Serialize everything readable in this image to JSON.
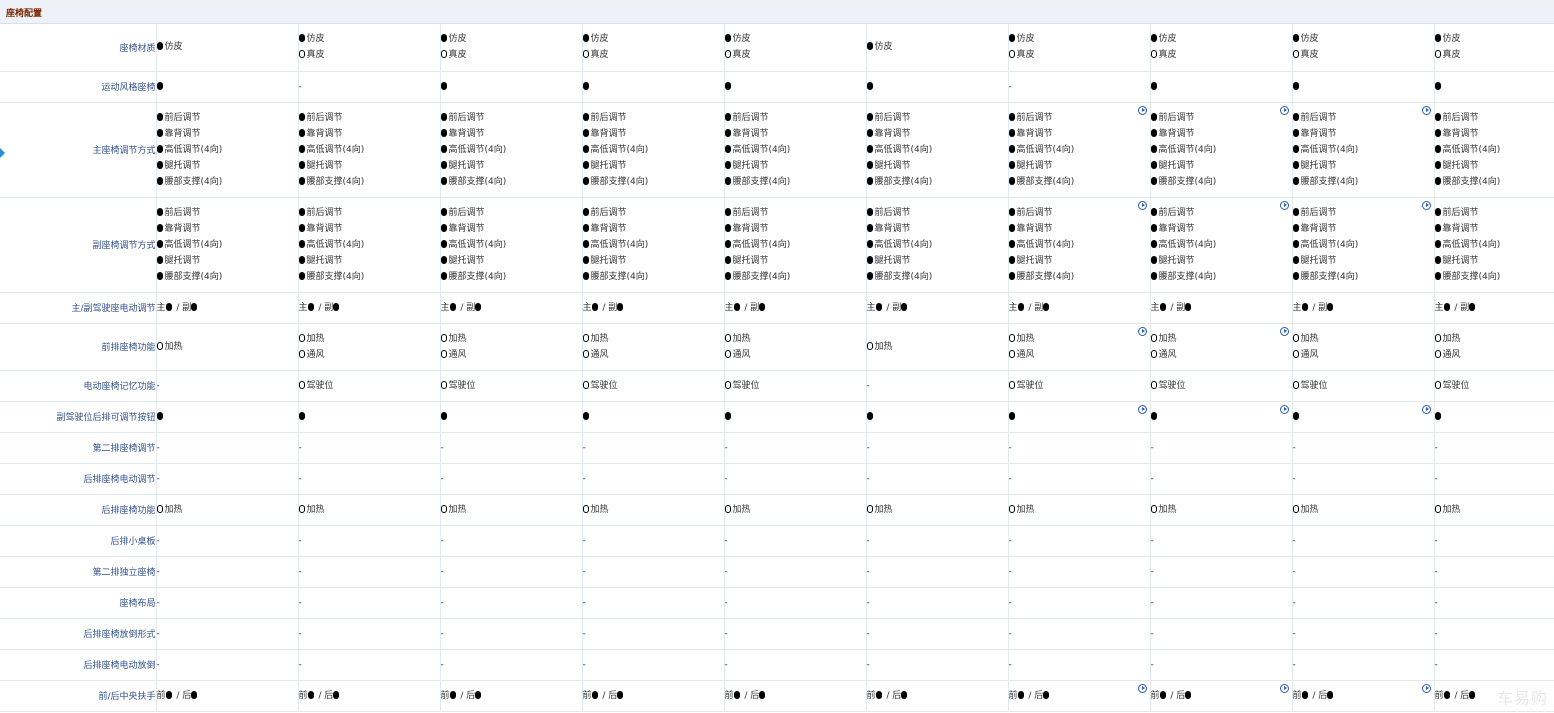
{
  "section_title": "座椅配置",
  "watermark": "车易购",
  "marks": {
    "filled": "●",
    "hollow": "○"
  },
  "rows": [
    {
      "label": "座椅材质",
      "h": 47,
      "cells": [
        [
          [
            "f",
            "仿皮"
          ]
        ],
        [
          [
            "f",
            "仿皮"
          ],
          [
            "o",
            "真皮"
          ]
        ],
        [
          [
            "f",
            "仿皮"
          ],
          [
            "o",
            "真皮"
          ]
        ],
        [
          [
            "f",
            "仿皮"
          ],
          [
            "o",
            "真皮"
          ]
        ],
        [
          [
            "f",
            "仿皮"
          ],
          [
            "o",
            "真皮"
          ]
        ],
        [
          [
            "f",
            "仿皮"
          ]
        ],
        [
          [
            "f",
            "仿皮"
          ],
          [
            "o",
            "真皮"
          ]
        ],
        [
          [
            "f",
            "仿皮"
          ],
          [
            "o",
            "真皮"
          ]
        ],
        [
          [
            "f",
            "仿皮"
          ],
          [
            "o",
            "真皮"
          ]
        ],
        [
          [
            "f",
            "仿皮"
          ],
          [
            "o",
            "真皮"
          ]
        ]
      ],
      "play": []
    },
    {
      "label": "运动风格座椅",
      "h": 31,
      "cells": [
        [
          [
            "f",
            ""
          ]
        ],
        [
          [
            "-",
            "-"
          ]
        ],
        [
          [
            "f",
            ""
          ]
        ],
        [
          [
            "f",
            ""
          ]
        ],
        [
          [
            "f",
            ""
          ]
        ],
        [
          [
            "f",
            ""
          ]
        ],
        [
          [
            "-",
            "-"
          ]
        ],
        [
          [
            "f",
            ""
          ]
        ],
        [
          [
            "f",
            ""
          ]
        ],
        [
          [
            "f",
            ""
          ]
        ]
      ],
      "play": []
    },
    {
      "label": "主座椅调节方式",
      "h": 95,
      "cells": "SEATADJ",
      "play": [
        6,
        7,
        8
      ]
    },
    {
      "label": "副座椅调节方式",
      "h": 95,
      "cells": "SEATADJ",
      "play": [
        6,
        7,
        8
      ]
    },
    {
      "label": "主/副驾驶座电动调节",
      "h": 31,
      "cells": "MAINSUB",
      "play": []
    },
    {
      "label": "前排座椅功能",
      "h": 47,
      "cells": [
        [
          [
            "o",
            "加热"
          ]
        ],
        [
          [
            "o",
            "加热"
          ],
          [
            "o",
            "通风"
          ]
        ],
        [
          [
            "o",
            "加热"
          ],
          [
            "o",
            "通风"
          ]
        ],
        [
          [
            "o",
            "加热"
          ],
          [
            "o",
            "通风"
          ]
        ],
        [
          [
            "o",
            "加热"
          ],
          [
            "o",
            "通风"
          ]
        ],
        [
          [
            "o",
            "加热"
          ]
        ],
        [
          [
            "o",
            "加热"
          ],
          [
            "o",
            "通风"
          ]
        ],
        [
          [
            "o",
            "加热"
          ],
          [
            "o",
            "通风"
          ]
        ],
        [
          [
            "o",
            "加热"
          ],
          [
            "o",
            "通风"
          ]
        ],
        [
          [
            "o",
            "加热"
          ],
          [
            "o",
            "通风"
          ]
        ]
      ],
      "play": [
        6,
        7
      ]
    },
    {
      "label": "电动座椅记忆功能",
      "h": 31,
      "cells": [
        [
          [
            "-",
            "-"
          ]
        ],
        [
          [
            "o",
            "驾驶位"
          ]
        ],
        [
          [
            "o",
            "驾驶位"
          ]
        ],
        [
          [
            "o",
            "驾驶位"
          ]
        ],
        [
          [
            "o",
            "驾驶位"
          ]
        ],
        [
          [
            "-",
            "-"
          ]
        ],
        [
          [
            "o",
            "驾驶位"
          ]
        ],
        [
          [
            "o",
            "驾驶位"
          ]
        ],
        [
          [
            "o",
            "驾驶位"
          ]
        ],
        [
          [
            "o",
            "驾驶位"
          ]
        ]
      ],
      "play": []
    },
    {
      "label": "副驾驶位后排可调节按钮",
      "h": 31,
      "cells": "ALLDOT",
      "play": [
        6,
        7,
        8
      ]
    },
    {
      "label": "第二排座椅调节",
      "h": 31,
      "cells": "ALLDASH",
      "play": []
    },
    {
      "label": "后排座椅电动调节",
      "h": 31,
      "cells": "ALLDASH",
      "play": []
    },
    {
      "label": "后排座椅功能",
      "h": 31,
      "cells": "ALLHEAT",
      "play": []
    },
    {
      "label": "后排小桌板",
      "h": 31,
      "cells": "ALLDASH",
      "play": []
    },
    {
      "label": "第二排独立座椅",
      "h": 31,
      "cells": "ALLDASH",
      "play": []
    },
    {
      "label": "座椅布局",
      "h": 31,
      "cells": "ALLDASH",
      "play": []
    },
    {
      "label": "后排座椅放倒形式",
      "h": 31,
      "cells": "ALLDASH",
      "play": []
    },
    {
      "label": "后排座椅电动放倒",
      "h": 31,
      "cells": "ALLDASH",
      "play": []
    },
    {
      "label": "前/后中央扶手",
      "h": 31,
      "cells": "FRONTREAR",
      "play": [
        6,
        7,
        8
      ]
    }
  ],
  "seat_adjust_items": [
    "前后调节",
    "靠背调节",
    "高低调节(4向)",
    "腿托调节",
    "腰部支撑(4向)"
  ],
  "main_sub": {
    "a": "主",
    "sep": "/",
    "b": "副"
  },
  "front_rear": {
    "a": "前",
    "sep": "/",
    "b": "后"
  },
  "heat_label": "加热",
  "column_count": 10
}
